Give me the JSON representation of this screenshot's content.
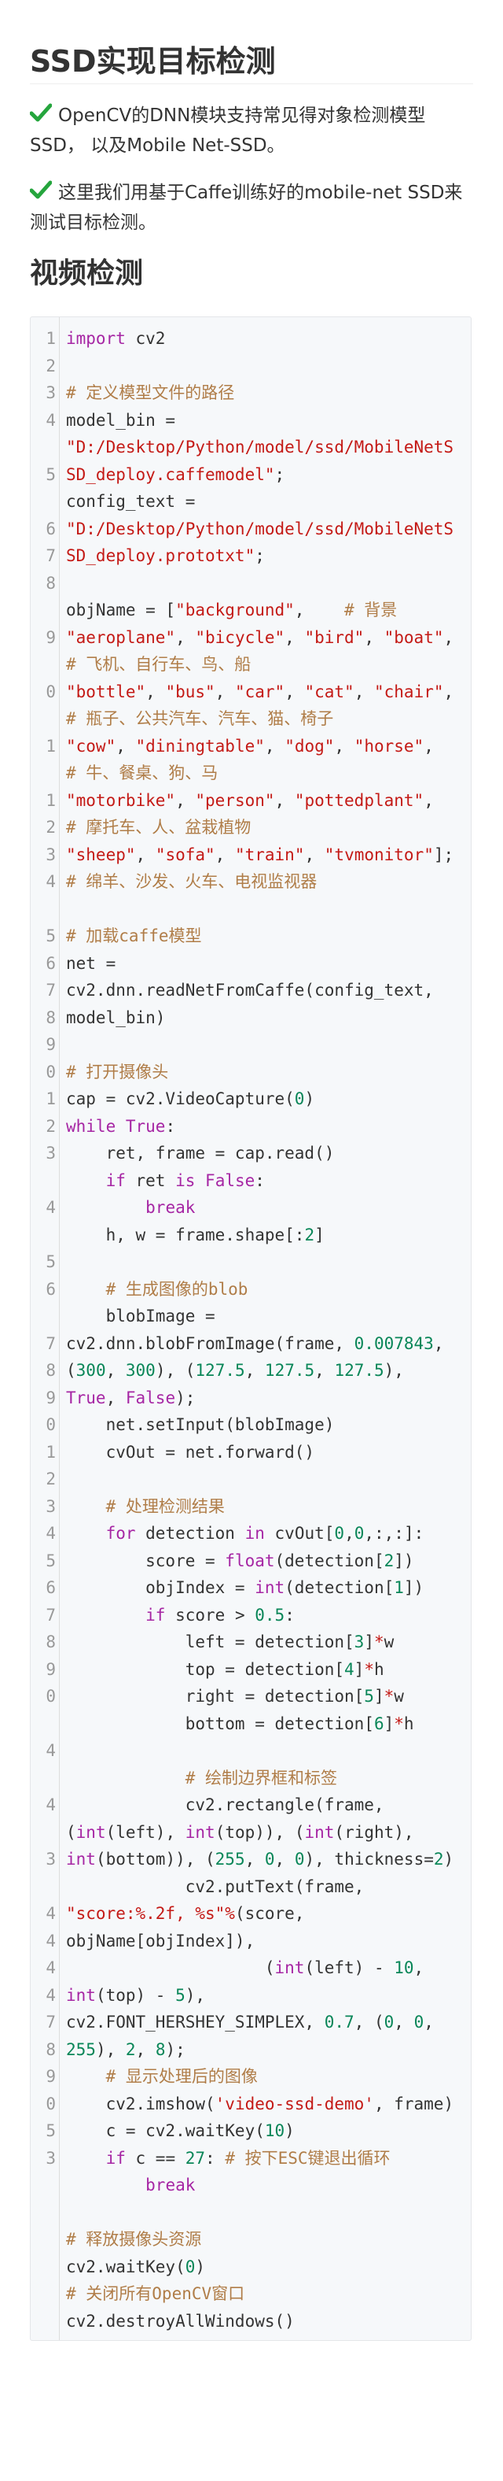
{
  "page": {
    "title": "SSD实现目标检测",
    "paragraphs": [
      {
        "icon": "check-icon",
        "lines": [
          "OpenCV的DNN模块支持常见得对象检测模型",
          "SSD， 以及Mobile Net-SSD。"
        ]
      },
      {
        "icon": "check-icon",
        "lines": [
          "这里我们用基于Caffe训练好的mobile-net SSD来",
          "测试目标检测。"
        ]
      }
    ],
    "section_heading": "视频检测",
    "accent_color": "#25a53d"
  },
  "code": {
    "language": "python",
    "line_numbers": [
      "1",
      "2",
      "3",
      "4",
      "",
      "5",
      "",
      "6",
      "7",
      "8",
      "",
      "9",
      "",
      "0",
      "",
      "1",
      "",
      "1",
      "2",
      "3",
      "4",
      "",
      "5",
      "6",
      "7",
      "8",
      "9",
      "0",
      "1",
      "2",
      "3",
      "",
      "4",
      "",
      "5",
      "6",
      "",
      "7",
      "8",
      "9",
      "0",
      "1",
      "2",
      "3",
      "4",
      "5",
      "6",
      "7",
      "8",
      "9",
      "0",
      "",
      "4",
      "",
      "4",
      "",
      "3",
      "",
      "4",
      "4",
      "4",
      "4",
      "7",
      "8",
      "9",
      "0",
      "5",
      "3"
    ],
    "lines": [
      [
        [
          "k",
          "import"
        ],
        [
          "f",
          " cv2"
        ]
      ],
      [],
      [
        [
          "c",
          "# 定义模型文件的路径"
        ]
      ],
      [
        [
          "f",
          "model_bin ="
        ]
      ],
      [
        [
          "s",
          "\"D:/Desktop/Python/model/ssd/MobileNetS"
        ]
      ],
      [
        [
          "s",
          "SD_deploy.caffemodel\""
        ],
        [
          "f",
          ";"
        ]
      ],
      [
        [
          "f",
          "config_text ="
        ]
      ],
      [
        [
          "s",
          "\"D:/Desktop/Python/model/ssd/MobileNetS"
        ]
      ],
      [
        [
          "s",
          "SD_deploy.prototxt\""
        ],
        [
          "f",
          ";"
        ]
      ],
      [],
      [
        [
          "f",
          "objName = ["
        ],
        [
          "s",
          "\"background\""
        ],
        [
          "f",
          ",    "
        ],
        [
          "c",
          "# 背景"
        ]
      ],
      [
        [
          "s",
          "\"aeroplane\""
        ],
        [
          "f",
          ", "
        ],
        [
          "s",
          "\"bicycle\""
        ],
        [
          "f",
          ", "
        ],
        [
          "s",
          "\"bird\""
        ],
        [
          "f",
          ", "
        ],
        [
          "s",
          "\"boat\""
        ],
        [
          "f",
          ","
        ]
      ],
      [
        [
          "c",
          "# 飞机、自行车、鸟、船"
        ]
      ],
      [
        [
          "s",
          "\"bottle\""
        ],
        [
          "f",
          ", "
        ],
        [
          "s",
          "\"bus\""
        ],
        [
          "f",
          ", "
        ],
        [
          "s",
          "\"car\""
        ],
        [
          "f",
          ", "
        ],
        [
          "s",
          "\"cat\""
        ],
        [
          "f",
          ", "
        ],
        [
          "s",
          "\"chair\""
        ],
        [
          "f",
          ","
        ]
      ],
      [
        [
          "c",
          "# 瓶子、公共汽车、汽车、猫、椅子"
        ]
      ],
      [
        [
          "s",
          "\"cow\""
        ],
        [
          "f",
          ", "
        ],
        [
          "s",
          "\"diningtable\""
        ],
        [
          "f",
          ", "
        ],
        [
          "s",
          "\"dog\""
        ],
        [
          "f",
          ", "
        ],
        [
          "s",
          "\"horse\""
        ],
        [
          "f",
          ","
        ]
      ],
      [
        [
          "c",
          "# 牛、餐桌、狗、马"
        ]
      ],
      [
        [
          "s",
          "\"motorbike\""
        ],
        [
          "f",
          ", "
        ],
        [
          "s",
          "\"person\""
        ],
        [
          "f",
          ", "
        ],
        [
          "s",
          "\"pottedplant\""
        ],
        [
          "f",
          ","
        ]
      ],
      [
        [
          "c",
          "# 摩托车、人、盆栽植物"
        ]
      ],
      [
        [
          "s",
          "\"sheep\""
        ],
        [
          "f",
          ", "
        ],
        [
          "s",
          "\"sofa\""
        ],
        [
          "f",
          ", "
        ],
        [
          "s",
          "\"train\""
        ],
        [
          "f",
          ", "
        ],
        [
          "s",
          "\"tvmonitor\""
        ],
        [
          "f",
          "];"
        ]
      ],
      [
        [
          "c",
          "# 绵羊、沙发、火车、电视监视器"
        ]
      ],
      [],
      [
        [
          "c",
          "# 加载caffe模型"
        ]
      ],
      [
        [
          "f",
          "net ="
        ]
      ],
      [
        [
          "f",
          "cv2.dnn.readNetFromCaffe(config_text,"
        ]
      ],
      [
        [
          "f",
          "model_bin)"
        ]
      ],
      [],
      [
        [
          "c",
          "# 打开摄像头"
        ]
      ],
      [
        [
          "f",
          "cap = cv2.VideoCapture("
        ],
        [
          "n",
          "0"
        ],
        [
          "f",
          ")"
        ]
      ],
      [
        [
          "k",
          "while"
        ],
        [
          "f",
          " "
        ],
        [
          "k",
          "True"
        ],
        [
          "f",
          ":"
        ]
      ],
      [
        [
          "f",
          "    ret, frame = cap.read()"
        ]
      ],
      [
        [
          "f",
          "    "
        ],
        [
          "k",
          "if"
        ],
        [
          "f",
          " ret "
        ],
        [
          "k",
          "is"
        ],
        [
          "f",
          " "
        ],
        [
          "k",
          "False"
        ],
        [
          "f",
          ":"
        ]
      ],
      [
        [
          "f",
          "        "
        ],
        [
          "k",
          "break"
        ]
      ],
      [
        [
          "f",
          "    h, w = frame.shape[:"
        ],
        [
          "n",
          "2"
        ],
        [
          "f",
          "]"
        ]
      ],
      [],
      [
        [
          "f",
          "    "
        ],
        [
          "c",
          "# 生成图像的blob"
        ]
      ],
      [
        [
          "f",
          "    blobImage ="
        ]
      ],
      [
        [
          "f",
          "cv2.dnn.blobFromImage(frame, "
        ],
        [
          "n",
          "0.007843"
        ],
        [
          "f",
          ","
        ]
      ],
      [
        [
          "f",
          "("
        ],
        [
          "n",
          "300"
        ],
        [
          "f",
          ", "
        ],
        [
          "n",
          "300"
        ],
        [
          "f",
          "), ("
        ],
        [
          "n",
          "127.5"
        ],
        [
          "f",
          ", "
        ],
        [
          "n",
          "127.5"
        ],
        [
          "f",
          ", "
        ],
        [
          "n",
          "127.5"
        ],
        [
          "f",
          "),"
        ]
      ],
      [
        [
          "k",
          "True"
        ],
        [
          "f",
          ", "
        ],
        [
          "k",
          "False"
        ],
        [
          "f",
          ");"
        ]
      ],
      [
        [
          "f",
          "    net.setInput(blobImage)"
        ]
      ],
      [
        [
          "f",
          "    cvOut = net.forward()"
        ]
      ],
      [],
      [
        [
          "f",
          "    "
        ],
        [
          "c",
          "# 处理检测结果"
        ]
      ],
      [
        [
          "f",
          "    "
        ],
        [
          "k",
          "for"
        ],
        [
          "f",
          " detection "
        ],
        [
          "k",
          "in"
        ],
        [
          "f",
          " cvOut["
        ],
        [
          "n",
          "0"
        ],
        [
          "f",
          ","
        ],
        [
          "n",
          "0"
        ],
        [
          "f",
          ",:,:]:"
        ]
      ],
      [
        [
          "f",
          "        score = "
        ],
        [
          "k",
          "float"
        ],
        [
          "f",
          "(detection["
        ],
        [
          "n",
          "2"
        ],
        [
          "f",
          "])"
        ]
      ],
      [
        [
          "f",
          "        objIndex = "
        ],
        [
          "k",
          "int"
        ],
        [
          "f",
          "(detection["
        ],
        [
          "n",
          "1"
        ],
        [
          "f",
          "])"
        ]
      ],
      [
        [
          "f",
          "        "
        ],
        [
          "k",
          "if"
        ],
        [
          "f",
          " score > "
        ],
        [
          "n",
          "0.5"
        ],
        [
          "f",
          ":"
        ]
      ],
      [
        [
          "f",
          "            left = detection["
        ],
        [
          "n",
          "3"
        ],
        [
          "f",
          "]"
        ],
        [
          "s",
          "*"
        ],
        [
          "f",
          "w"
        ]
      ],
      [
        [
          "f",
          "            top = detection["
        ],
        [
          "n",
          "4"
        ],
        [
          "f",
          "]"
        ],
        [
          "s",
          "*"
        ],
        [
          "f",
          "h"
        ]
      ],
      [
        [
          "f",
          "            right = detection["
        ],
        [
          "n",
          "5"
        ],
        [
          "f",
          "]"
        ],
        [
          "s",
          "*"
        ],
        [
          "f",
          "w"
        ]
      ],
      [
        [
          "f",
          "            bottom = detection["
        ],
        [
          "n",
          "6"
        ],
        [
          "f",
          "]"
        ],
        [
          "s",
          "*"
        ],
        [
          "f",
          "h"
        ]
      ],
      [],
      [
        [
          "f",
          "            "
        ],
        [
          "c",
          "# 绘制边界框和标签"
        ]
      ],
      [
        [
          "f",
          "            cv2.rectangle(frame,"
        ]
      ],
      [
        [
          "f",
          "("
        ],
        [
          "k",
          "int"
        ],
        [
          "f",
          "(left), "
        ],
        [
          "k",
          "int"
        ],
        [
          "f",
          "(top)), ("
        ],
        [
          "k",
          "int"
        ],
        [
          "f",
          "(right),"
        ]
      ],
      [
        [
          "k",
          "int"
        ],
        [
          "f",
          "(bottom)), ("
        ],
        [
          "n",
          "255"
        ],
        [
          "f",
          ", "
        ],
        [
          "n",
          "0"
        ],
        [
          "f",
          ", "
        ],
        [
          "n",
          "0"
        ],
        [
          "f",
          "), thickness="
        ],
        [
          "n",
          "2"
        ],
        [
          "f",
          ")"
        ]
      ],
      [
        [
          "f",
          "            cv2.putText(frame,"
        ]
      ],
      [
        [
          "s",
          "\"score:%.2f, %s\""
        ],
        [
          "s",
          "%"
        ],
        [
          "f",
          "(score,"
        ]
      ],
      [
        [
          "f",
          "objName[objIndex]),"
        ]
      ],
      [
        [
          "f",
          "                    ("
        ],
        [
          "k",
          "int"
        ],
        [
          "f",
          "(left) - "
        ],
        [
          "n",
          "10"
        ],
        [
          "f",
          ","
        ]
      ],
      [
        [
          "k",
          "int"
        ],
        [
          "f",
          "(top) - "
        ],
        [
          "n",
          "5"
        ],
        [
          "f",
          "),"
        ]
      ],
      [
        [
          "f",
          "cv2.FONT_HERSHEY_SIMPLEX, "
        ],
        [
          "n",
          "0.7"
        ],
        [
          "f",
          ", ("
        ],
        [
          "n",
          "0"
        ],
        [
          "f",
          ", "
        ],
        [
          "n",
          "0"
        ],
        [
          "f",
          ","
        ]
      ],
      [
        [
          "n",
          "255"
        ],
        [
          "f",
          "), "
        ],
        [
          "n",
          "2"
        ],
        [
          "f",
          ", "
        ],
        [
          "n",
          "8"
        ],
        [
          "f",
          ");"
        ]
      ],
      [
        [
          "f",
          "    "
        ],
        [
          "c",
          "# 显示处理后的图像"
        ]
      ],
      [
        [
          "f",
          "    cv2.imshow("
        ],
        [
          "s",
          "'video-ssd-demo'"
        ],
        [
          "f",
          ", frame)"
        ]
      ],
      [
        [
          "f",
          "    c = cv2.waitKey("
        ],
        [
          "n",
          "10"
        ],
        [
          "f",
          ")"
        ]
      ],
      [
        [
          "f",
          "    "
        ],
        [
          "k",
          "if"
        ],
        [
          "f",
          " c == "
        ],
        [
          "n",
          "27"
        ],
        [
          "f",
          ": "
        ],
        [
          "c",
          "# 按下ESC键退出循环"
        ]
      ],
      [
        [
          "f",
          "        "
        ],
        [
          "k",
          "break"
        ]
      ],
      [],
      [
        [
          "c",
          "# 释放摄像头资源"
        ]
      ],
      [
        [
          "f",
          "cv2.waitKey("
        ],
        [
          "n",
          "0"
        ],
        [
          "f",
          ")"
        ]
      ],
      [
        [
          "c",
          "# 关闭所有OpenCV窗口"
        ]
      ],
      [
        [
          "f",
          "cv2.destroyAllWindows()"
        ]
      ]
    ]
  }
}
